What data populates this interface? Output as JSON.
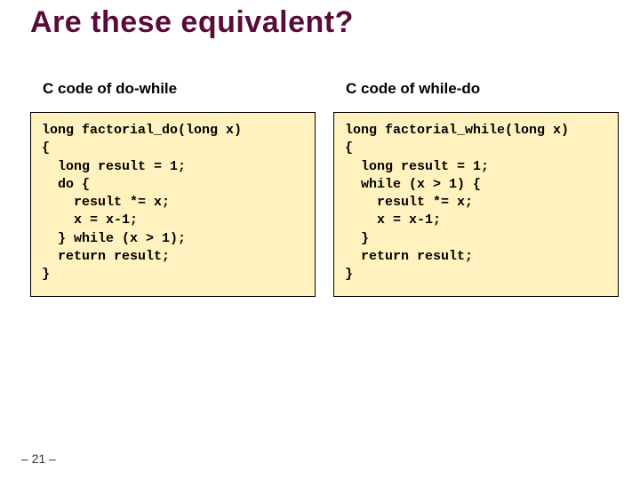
{
  "title": "Are these equivalent?",
  "left": {
    "label": "C code of do-while",
    "code": "long factorial_do(long x)\n{\n  long result = 1;\n  do {\n    result *= x;\n    x = x-1;\n  } while (x > 1);\n  return result;\n}"
  },
  "right": {
    "label": "C code of while-do",
    "code": "long factorial_while(long x)\n{\n  long result = 1;\n  while (x > 1) {\n    result *= x;\n    x = x-1;\n  }\n  return result;\n}"
  },
  "pageNumber": "– 21 –"
}
